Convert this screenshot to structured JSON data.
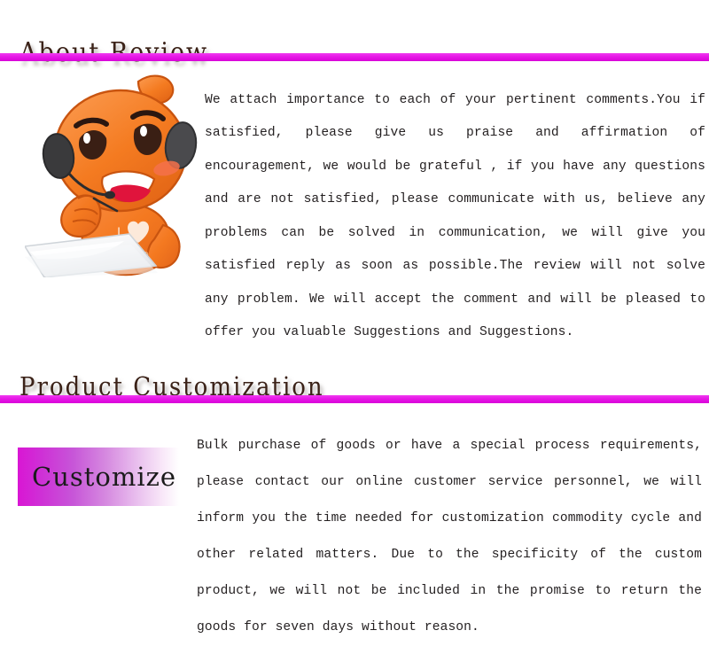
{
  "page": {
    "background": "#ffffff",
    "accent_color": "#dd00dd",
    "text_color": "#231f20"
  },
  "sections": [
    {
      "heading": "About Review",
      "divider_color": "#dd00dd",
      "illustration": "customer-service-mascot",
      "body": "We attach importance to each of your pertinent comments.You if satisfied, please give us praise and affirmation of encouragement, we would be grateful  , if you have any questions and are not satisfied, please communicate with us, believe any problems can be solved in communication, we will give you satisfied reply as soon as possible.The review will not solve any problem. We will accept the comment and will be pleased to offer you valuable Suggestions and Suggestions."
    },
    {
      "heading": "Product Customization",
      "divider_color": "#dd00dd",
      "badge_label": "Customize",
      "badge_gradient_from": "#d916d4",
      "badge_gradient_to": "#ffffff",
      "body": "Bulk purchase of goods or have a special process requirements, please contact our online customer service personnel, we will inform you the time needed for customization commodity cycle and other related matters. Due to the specificity of the custom product, we will not be included in the promise to return the goods for seven days without reason."
    }
  ]
}
